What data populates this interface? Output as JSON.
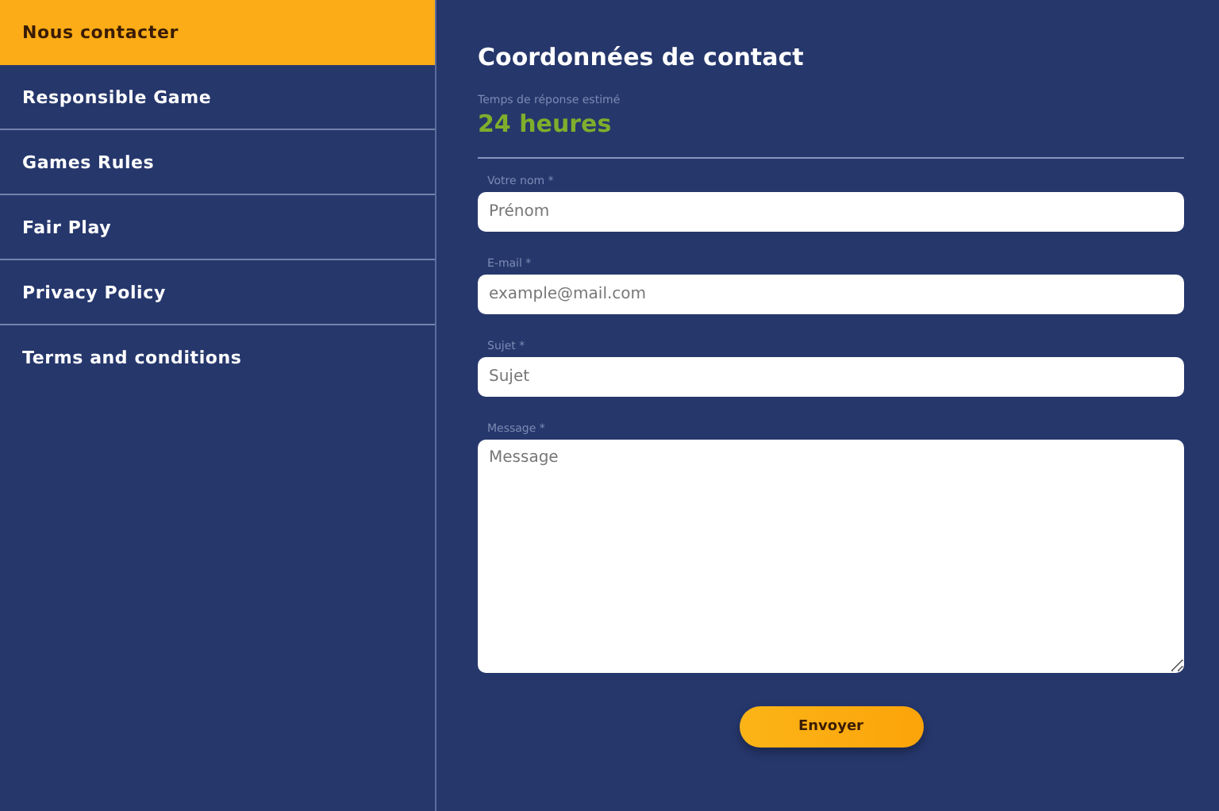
{
  "sidebar": {
    "items": [
      {
        "label": "Nous contacter",
        "selected": true
      },
      {
        "label": "Responsible Game",
        "selected": false
      },
      {
        "label": "Games Rules",
        "selected": false
      },
      {
        "label": "Fair Play",
        "selected": false
      },
      {
        "label": "Privacy Policy",
        "selected": false
      },
      {
        "label": "Terms and conditions",
        "selected": false
      }
    ]
  },
  "main": {
    "title": "Coordonnées de contact",
    "response_label": "Temps de réponse estimé",
    "response_value": "24 heures",
    "fields": [
      {
        "kind": "input",
        "label": "Votre nom *",
        "placeholder": "Prénom"
      },
      {
        "kind": "input",
        "label": "E-mail *",
        "placeholder": "example@mail.com"
      },
      {
        "kind": "input",
        "label": "Sujet *",
        "placeholder": "Sujet"
      },
      {
        "kind": "textarea",
        "label": "Message *",
        "placeholder": "Message"
      }
    ],
    "submit": "Envoyer"
  }
}
